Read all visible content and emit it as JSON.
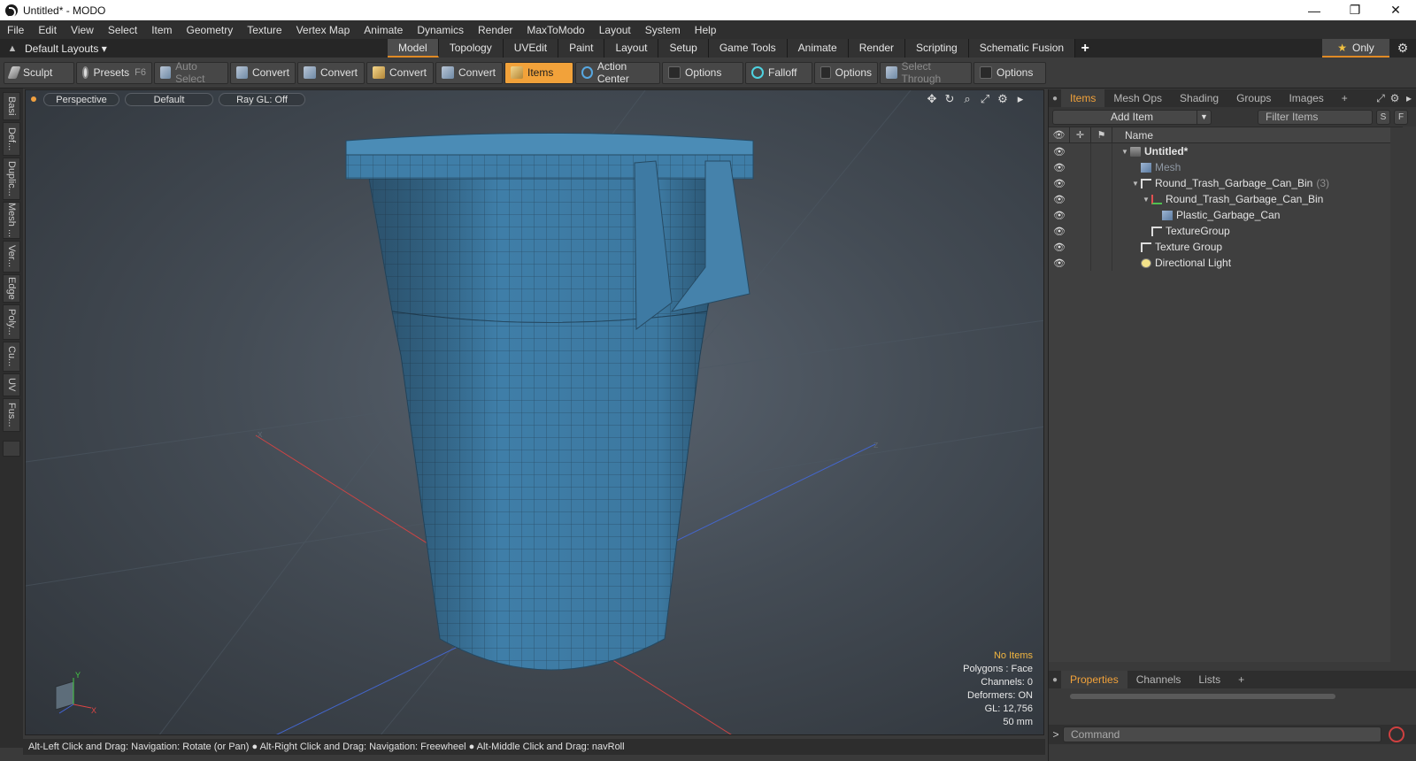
{
  "window": {
    "title": "Untitled* - MODO",
    "controls": [
      "—",
      "❐",
      "✕"
    ]
  },
  "menu": [
    "File",
    "Edit",
    "View",
    "Select",
    "Item",
    "Geometry",
    "Texture",
    "Vertex Map",
    "Animate",
    "Dynamics",
    "Render",
    "MaxToModo",
    "Layout",
    "System",
    "Help"
  ],
  "layoutbar": {
    "layouts_label": "Default Layouts ▾",
    "tabs": [
      "Model",
      "Topology",
      "UVEdit",
      "Paint",
      "Layout",
      "Setup",
      "Game Tools",
      "Animate",
      "Render",
      "Scripting",
      "Schematic Fusion"
    ],
    "active_tab": "Model",
    "only_label": "Only"
  },
  "toolbar": {
    "sculpt": "Sculpt",
    "presets": "Presets",
    "presets_key": "F6",
    "auto_select": "Auto Select",
    "convert": "Convert",
    "items": "Items",
    "action_center": "Action Center",
    "options": "Options",
    "falloff": "Falloff",
    "select_through": "Select Through"
  },
  "left_tabs": [
    "Basi",
    "Def...",
    "Duplic...",
    "Mesh ...",
    "Ver...",
    "Edge",
    "Poly...",
    "Cu...",
    "UV",
    "Fus..."
  ],
  "viewport": {
    "view_mode": "Perspective",
    "shading": "Default",
    "raygl": "Ray GL: Off",
    "stats": {
      "selection": "No Items",
      "polygons": "Polygons : Face",
      "channels": "Channels: 0",
      "deformers": "Deformers: ON",
      "gl": "GL: 12,756",
      "scale": "50 mm"
    }
  },
  "status": "Alt-Left Click and Drag: Navigation: Rotate (or Pan) ● Alt-Right Click and Drag: Navigation: Freewheel ● Alt-Middle Click and Drag: navRoll",
  "panel": {
    "tabs": [
      "Items",
      "Mesh Ops",
      "Shading",
      "Groups",
      "Images"
    ],
    "add_item": "Add Item",
    "filter_placeholder": "Filter Items",
    "column_name": "Name",
    "tree": [
      {
        "label": "Untitled*",
        "indent": 0,
        "twisty": "▼",
        "icon": "scene",
        "bold": true
      },
      {
        "label": "Mesh",
        "indent": 1,
        "twisty": "",
        "icon": "mesh",
        "dim": true
      },
      {
        "label": "Round_Trash_Garbage_Can_Bin",
        "count": "(3)",
        "indent": 1,
        "twisty": "▼",
        "icon": "group"
      },
      {
        "label": "Round_Trash_Garbage_Can_Bin",
        "indent": 2,
        "twisty": "▼",
        "icon": "locator"
      },
      {
        "label": "Plastic_Garbage_Can",
        "indent": 3,
        "twisty": "",
        "icon": "mesh"
      },
      {
        "label": "TextureGroup",
        "indent": 2,
        "twisty": "",
        "icon": "group"
      },
      {
        "label": "Texture Group",
        "indent": 1,
        "twisty": "",
        "icon": "group"
      },
      {
        "label": "Directional Light",
        "indent": 1,
        "twisty": "",
        "icon": "light"
      }
    ],
    "bottom_tabs": [
      "Properties",
      "Channels",
      "Lists"
    ],
    "command_placeholder": "Command"
  }
}
